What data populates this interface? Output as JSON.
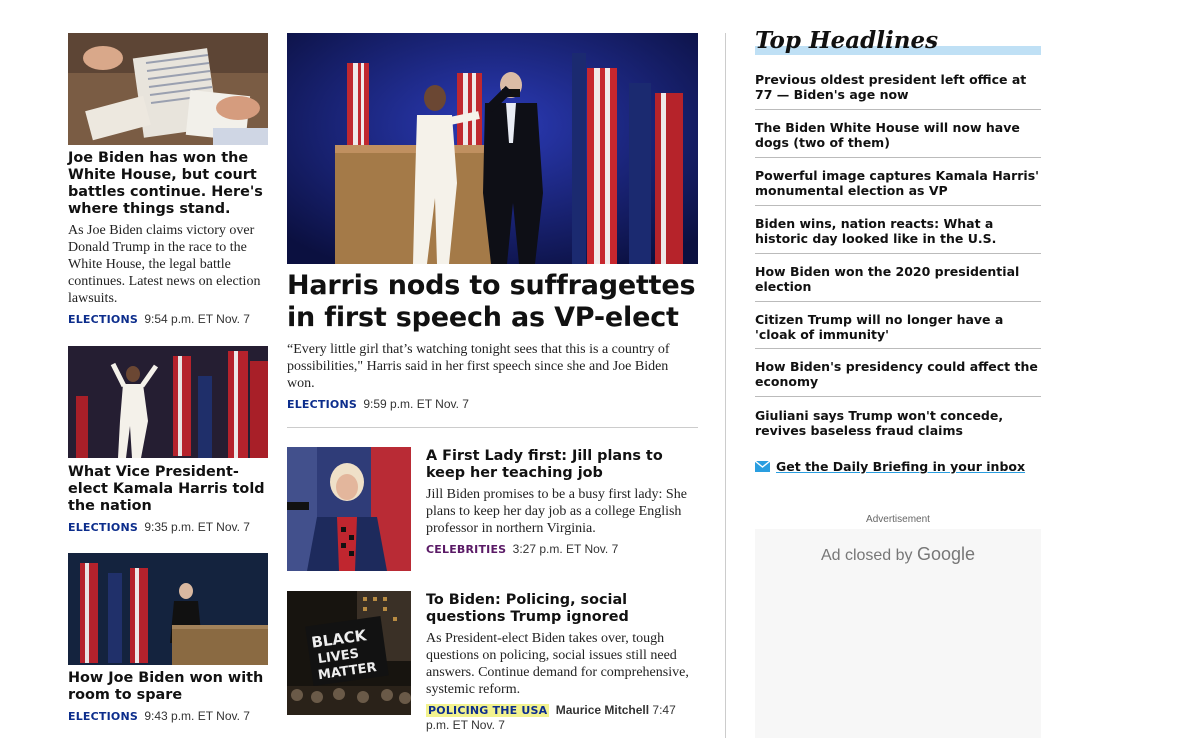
{
  "left_stories": [
    {
      "headline": "Joe Biden has won the White House, but court battles continue. Here's where things stand.",
      "summary": "As Joe Biden claims victory over Donald Trump in the race to the White House, the legal battle continues. Latest news on election lawsuits.",
      "tag": "ELECTIONS",
      "time": "9:54 p.m. ET Nov. 7"
    },
    {
      "headline": "What Vice President-elect Kamala Harris told the nation",
      "tag": "ELECTIONS",
      "time": "9:35 p.m. ET Nov. 7"
    },
    {
      "headline": "How Joe Biden won with room to spare",
      "tag": "ELECTIONS",
      "time": "9:43 p.m. ET Nov. 7"
    }
  ],
  "main_story": {
    "headline": "Harris nods to suffragettes in first speech as VP-elect",
    "summary": "“Every little girl that’s watching tonight sees that this is a country of possibilities,\" Harris said in her first speech since she and Joe Biden won.",
    "tag": "ELECTIONS",
    "time": "9:59 p.m. ET Nov. 7"
  },
  "center_stories": [
    {
      "headline": "A First Lady first: Jill plans to keep her teaching job",
      "summary": "Jill Biden promises to be a busy first lady: She plans to keep her day job as a college English professor in northern Virginia.",
      "tag": "CELEBRITIES",
      "time": "3:27 p.m. ET Nov. 7"
    },
    {
      "headline": "To Biden: Policing, social questions Trump ignored",
      "summary": "As President-elect Biden takes over, tough questions on policing, social issues still need answers. Continue demand for comprehensive, systemic reform.",
      "tag": "POLICING THE USA",
      "author": "Maurice Mitchell",
      "time_a": "7:47 p.m. ET",
      "time_b": "Nov. 7"
    }
  ],
  "top_headlines": {
    "title": "Top Headlines",
    "items": [
      "Previous oldest president left office at 77 — Biden's age now",
      "The Biden White House will now have dogs (two of them)",
      "Powerful image captures Kamala Harris' monumental election as VP",
      "Biden wins, nation reacts: What a historic day looked like in the U.S.",
      "How Biden won the 2020 presidential election",
      "Citizen Trump will no longer have a 'cloak of immunity'",
      "How Biden's presidency could affect the economy",
      "Giuliani says Trump won't concede, revives baseless fraud claims"
    ],
    "briefing_link": "Get the Daily Briefing in your inbox"
  },
  "ad": {
    "label": "Advertisement",
    "closed_text": "Ad closed by",
    "closed_brand": "Google"
  },
  "colors": {
    "elections_tag": "#0c2d8c",
    "celebrities_tag": "#5a1a66",
    "policing_highlight": "#f2f28f",
    "headline_bar": "#bfe0f5"
  }
}
